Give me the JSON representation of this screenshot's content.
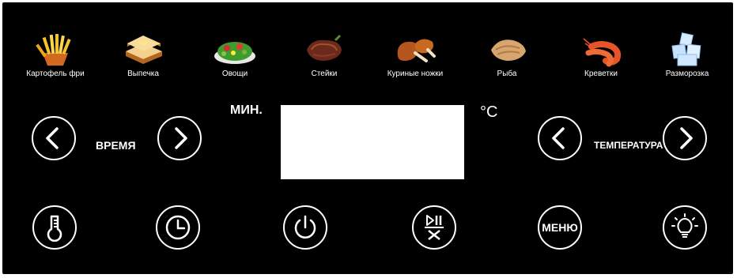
{
  "presets": [
    {
      "label": "Картофель фри",
      "icon": "fries-icon"
    },
    {
      "label": "Выпечка",
      "icon": "bread-icon"
    },
    {
      "label": "Овощи",
      "icon": "salad-icon"
    },
    {
      "label": "Стейки",
      "icon": "steak-icon"
    },
    {
      "label": "Куриные ножки",
      "icon": "drumstick-icon"
    },
    {
      "label": "Рыба",
      "icon": "fish-icon"
    },
    {
      "label": "Креветки",
      "icon": "shrimp-icon"
    },
    {
      "label": "Разморозка",
      "icon": "ice-icon"
    }
  ],
  "time": {
    "label": "ВРЕМЯ",
    "unit": "МИН."
  },
  "temperature": {
    "label": "ТЕМПЕРАТУРА",
    "unit": "°C"
  },
  "bottom": {
    "menu_label": "МЕНЮ"
  },
  "colors": {
    "panel": "#000000",
    "foreground": "#ffffff",
    "display": "#ffffff"
  }
}
